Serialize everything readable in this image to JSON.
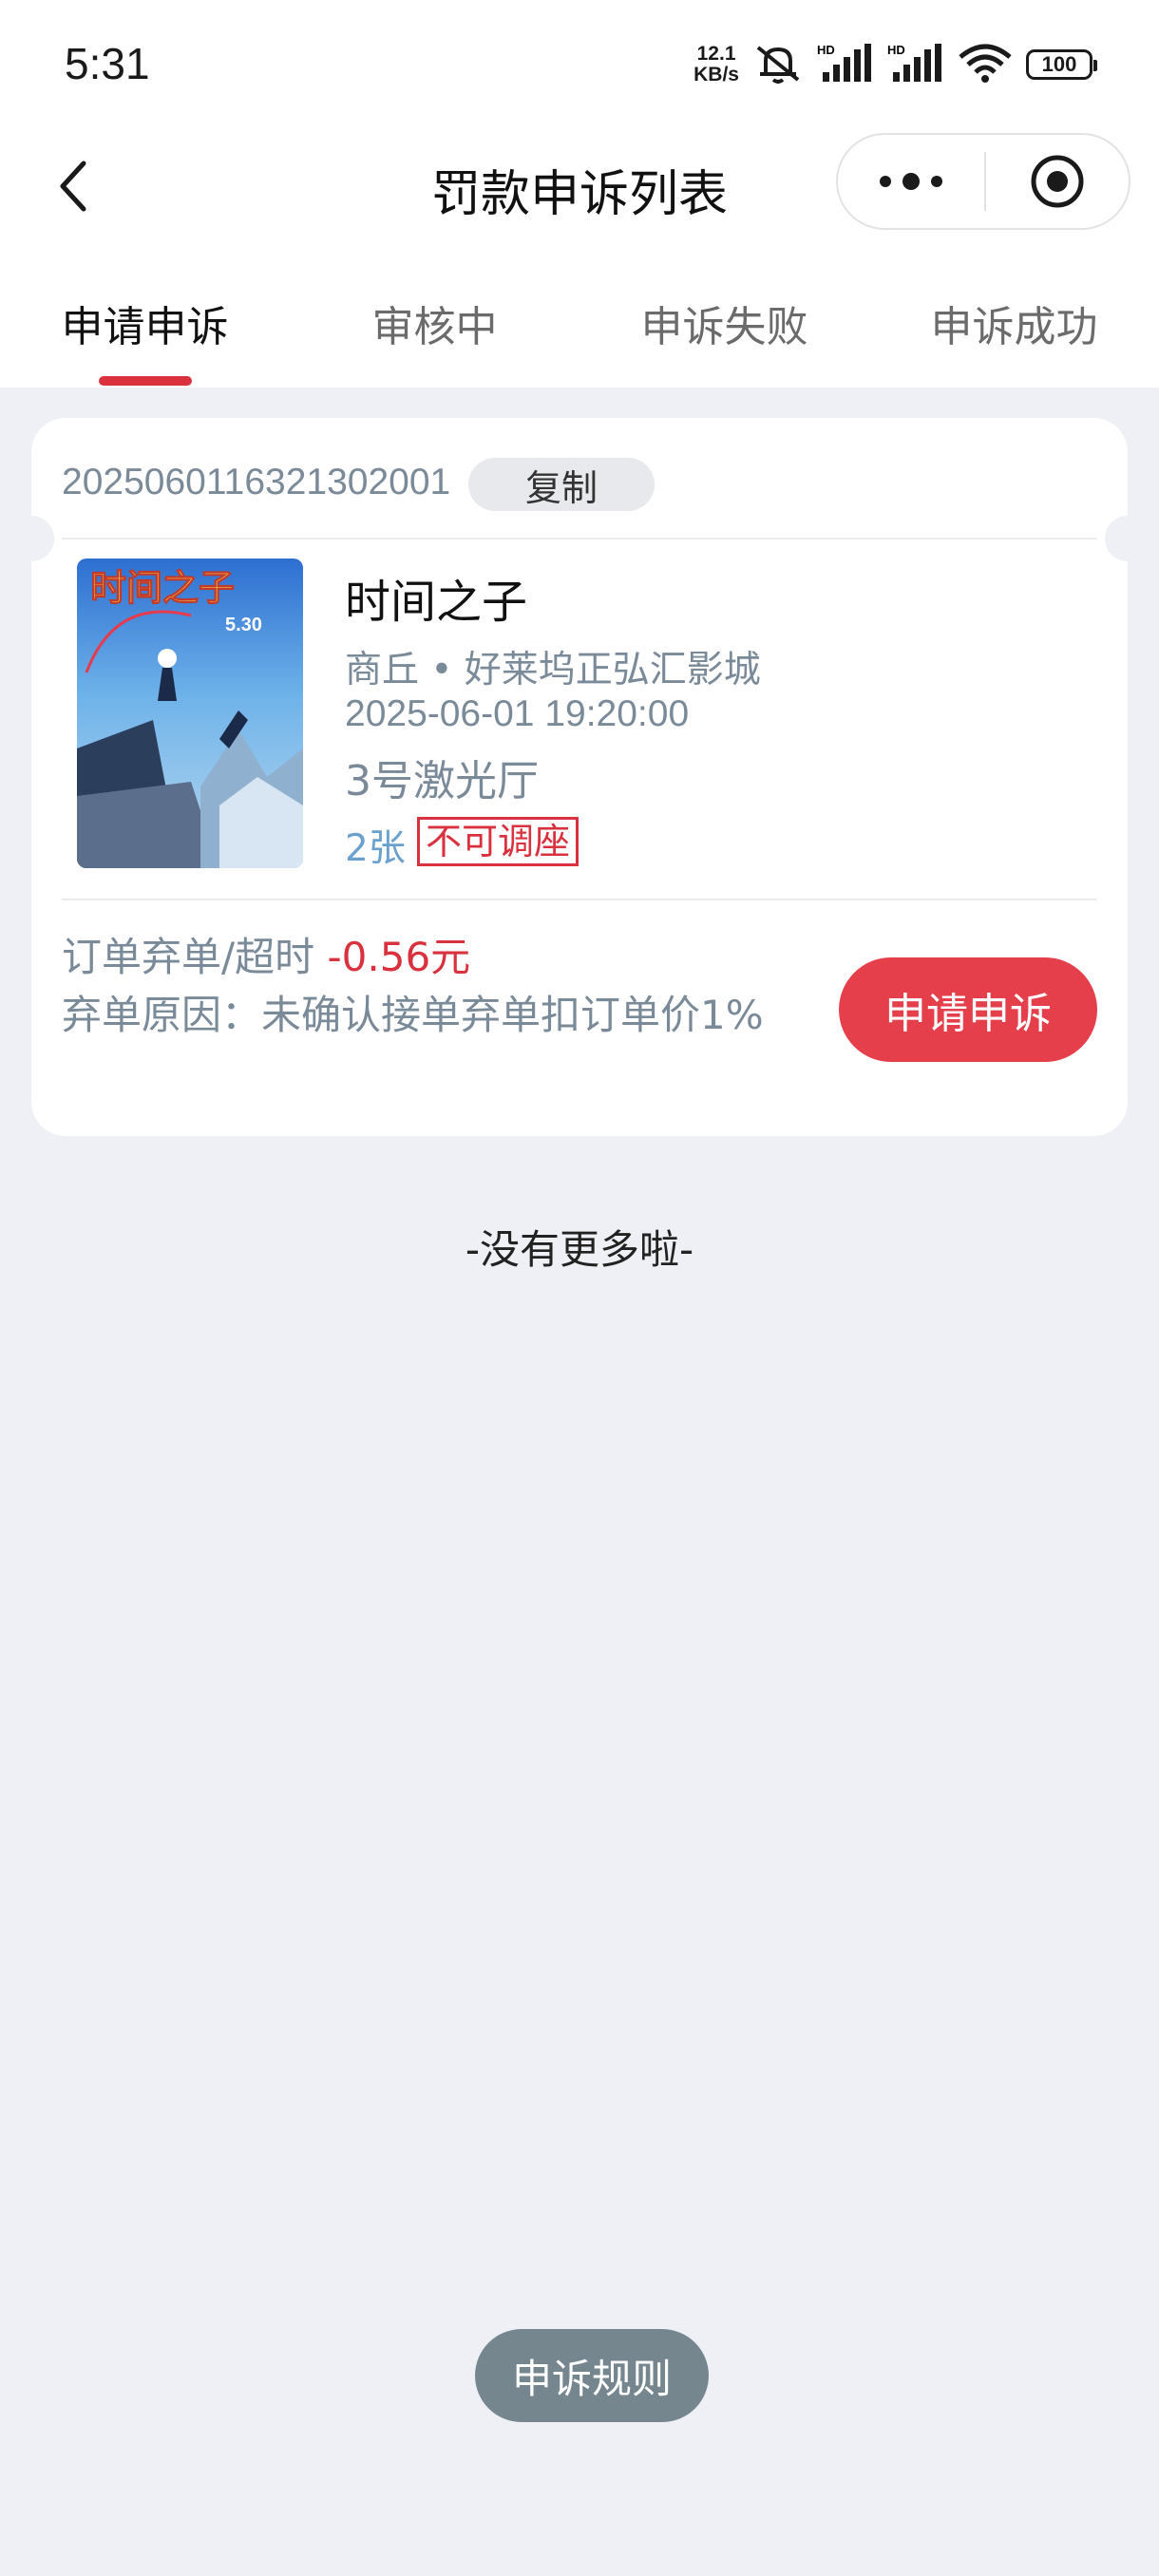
{
  "status_bar": {
    "time": "5:31",
    "net_speed_value": "12.1",
    "net_speed_unit": "KB/s",
    "battery": "100"
  },
  "nav": {
    "title": "罚款申诉列表"
  },
  "tabs": [
    {
      "label": "申请申诉",
      "active": true
    },
    {
      "label": "审核中",
      "active": false
    },
    {
      "label": "申诉失败",
      "active": false
    },
    {
      "label": "申诉成功",
      "active": false
    }
  ],
  "card": {
    "order_no": "2025060116321302001",
    "copy_label": "复制",
    "movie_title": "时间之子",
    "cinema": "商丘 • 好莱坞正弘汇影城",
    "showtime": "2025-06-01 19:20:00",
    "hall": "3号激光厅",
    "tickets": "2张",
    "seat_tag": "不可调座",
    "penalty_label": "订单弃单/超时",
    "penalty_amount": "-0.56元",
    "reason": "弃单原因：未确认接单弃单扣订单价1%",
    "apply_label": "申请申诉",
    "poster_title": "时间之子",
    "poster_date": "5.30"
  },
  "footer": {
    "no_more": "-没有更多啦-",
    "rules_label": "申诉规则"
  },
  "colors": {
    "accent_red": "#d9323e",
    "button_red": "#e53f4c",
    "muted_text": "#7a8a99",
    "link_blue": "#6aa0cc",
    "background": "#eef0f5",
    "rules_button": "#75868f"
  }
}
